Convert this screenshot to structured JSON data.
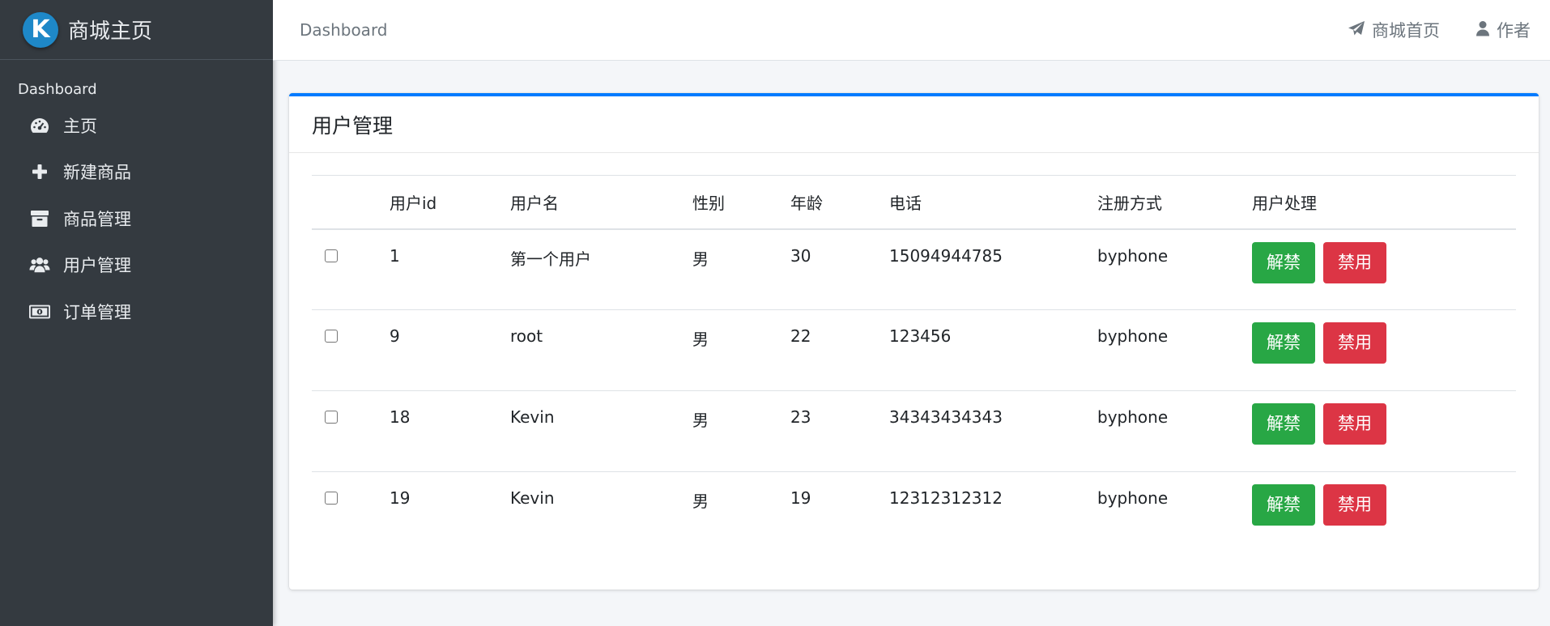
{
  "sidebar": {
    "brand": "商城主页",
    "brand_logo_letter": "K",
    "header": "Dashboard",
    "items": [
      {
        "label": "主页",
        "icon": "dashboard-gauge-icon"
      },
      {
        "label": "新建商品",
        "icon": "plus-icon"
      },
      {
        "label": "商品管理",
        "icon": "archive-box-icon"
      },
      {
        "label": "用户管理",
        "icon": "users-icon"
      },
      {
        "label": "订单管理",
        "icon": "money-bill-icon"
      }
    ]
  },
  "topbar": {
    "breadcrumb": "Dashboard",
    "home_link": "商城首页",
    "author_link": "作者"
  },
  "card": {
    "title": "用户管理",
    "accent_color": "#007bff",
    "columns": [
      "",
      "用户id",
      "用户名",
      "性别",
      "年龄",
      "电话",
      "注册方式",
      "用户处理"
    ],
    "unban_label": "解禁",
    "ban_label": "禁用",
    "rows": [
      {
        "id": "1",
        "name": "第一个用户",
        "gender": "男",
        "age": "30",
        "phone": "15094944785",
        "reg": "byphone"
      },
      {
        "id": "9",
        "name": "root",
        "gender": "男",
        "age": "22",
        "phone": "123456",
        "reg": "byphone"
      },
      {
        "id": "18",
        "name": "Kevin",
        "gender": "男",
        "age": "23",
        "phone": "34343434343",
        "reg": "byphone"
      },
      {
        "id": "19",
        "name": "Kevin",
        "gender": "男",
        "age": "19",
        "phone": "12312312312",
        "reg": "byphone"
      }
    ]
  }
}
